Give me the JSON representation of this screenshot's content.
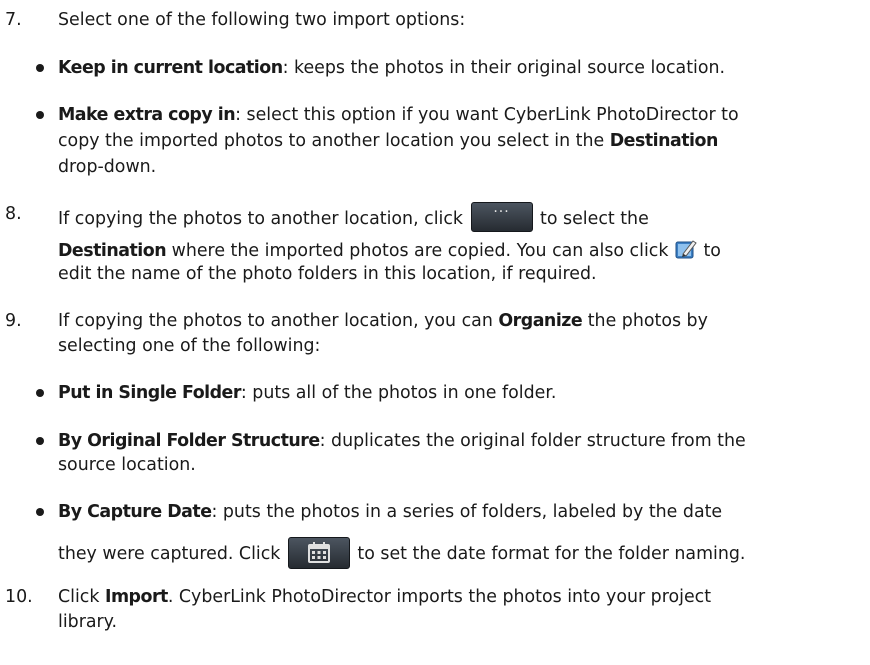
{
  "steps": {
    "s7": {
      "number": "7.",
      "text": "Select one of the following two import options:",
      "options": [
        {
          "label": "Keep in current location",
          "desc": ": keeps the photos in their original source location."
        },
        {
          "label": "Make extra copy in",
          "desc1": ": select this option if you want CyberLink PhotoDirector to",
          "desc2": "copy the imported photos to another location you select in the ",
          "desc2_bold": "Destination",
          "desc3": "drop-down."
        }
      ]
    },
    "s8": {
      "number": "8.",
      "text1a": "If copying the photos to another location, click ",
      "text1b": " to select the",
      "bold2": "Destination",
      "text2": " where the imported photos are copied. You can also click ",
      "text2b": " to",
      "text3": "edit the name of the photo folders in this location, if required.",
      "browse_icon": "ellipsis-button-icon",
      "edit_icon": "edit-folder-icon"
    },
    "s9": {
      "number": "9.",
      "text1": "If copying the photos to another location, you can ",
      "bold1": "Organize",
      "text1b": " the photos by",
      "text2": "selecting one of the following:",
      "options": [
        {
          "label": "Put in Single Folder",
          "desc": ": puts all of the photos in one folder."
        },
        {
          "label": "By Original Folder Structure",
          "desc1": ": duplicates the original folder structure from the",
          "desc2": "source location."
        },
        {
          "label": "By Capture Date",
          "desc1": ": puts the photos in a series of folders, labeled by the date",
          "desc2a": "they were captured. Click ",
          "desc2b": " to set the date format for the folder naming."
        }
      ],
      "calendar_icon": "calendar-button-icon"
    },
    "s10": {
      "number": "10.",
      "text1a": "Click ",
      "bold1": "Import",
      "text1b": ". CyberLink PhotoDirector imports the photos into your project",
      "text2": "library."
    }
  }
}
